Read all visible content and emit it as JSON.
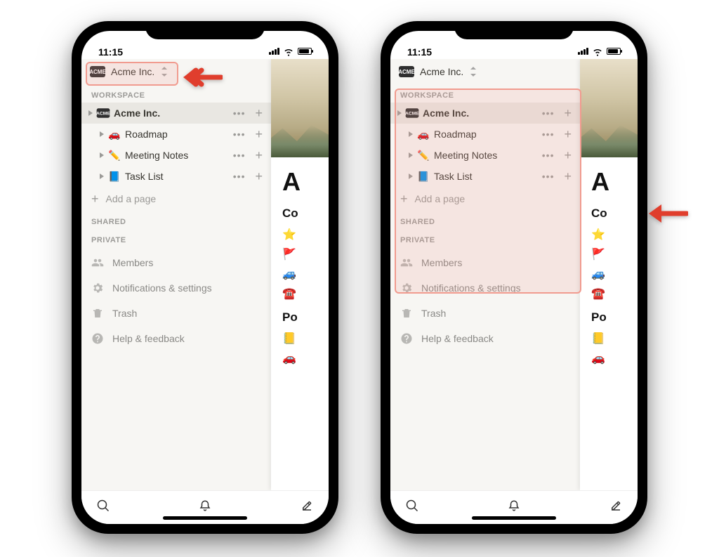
{
  "statusbar": {
    "time": "11:15"
  },
  "workspace": {
    "badge": "ACME",
    "name": "Acme Inc."
  },
  "sections": {
    "workspace_label": "WORKSPACE",
    "shared_label": "SHARED",
    "private_label": "PRIVATE"
  },
  "pages": [
    {
      "icon_text": "ACME",
      "label": "Acme Inc.",
      "selected": true,
      "depth": 0,
      "bold": true
    },
    {
      "icon_text": "🚗",
      "label": "Roadmap",
      "selected": false,
      "depth": 1,
      "bold": false
    },
    {
      "icon_text": "✏️",
      "label": "Meeting Notes",
      "selected": false,
      "depth": 1,
      "bold": false
    },
    {
      "icon_text": "📘",
      "label": "Task List",
      "selected": false,
      "depth": 1,
      "bold": false
    }
  ],
  "add_page_label": "Add a page",
  "utilities": [
    {
      "icon": "members",
      "label": "Members"
    },
    {
      "icon": "gear",
      "label": "Notifications & settings"
    },
    {
      "icon": "trash",
      "label": "Trash"
    },
    {
      "icon": "help",
      "label": "Help & feedback"
    }
  ],
  "peek": {
    "title_initial": "A",
    "subheading1": "Co",
    "emoji_col1": [
      "⭐",
      "🚩",
      "🚙",
      "☎️"
    ],
    "subheading2": "Po",
    "emoji_col2": [
      "📒",
      "🚗"
    ]
  }
}
